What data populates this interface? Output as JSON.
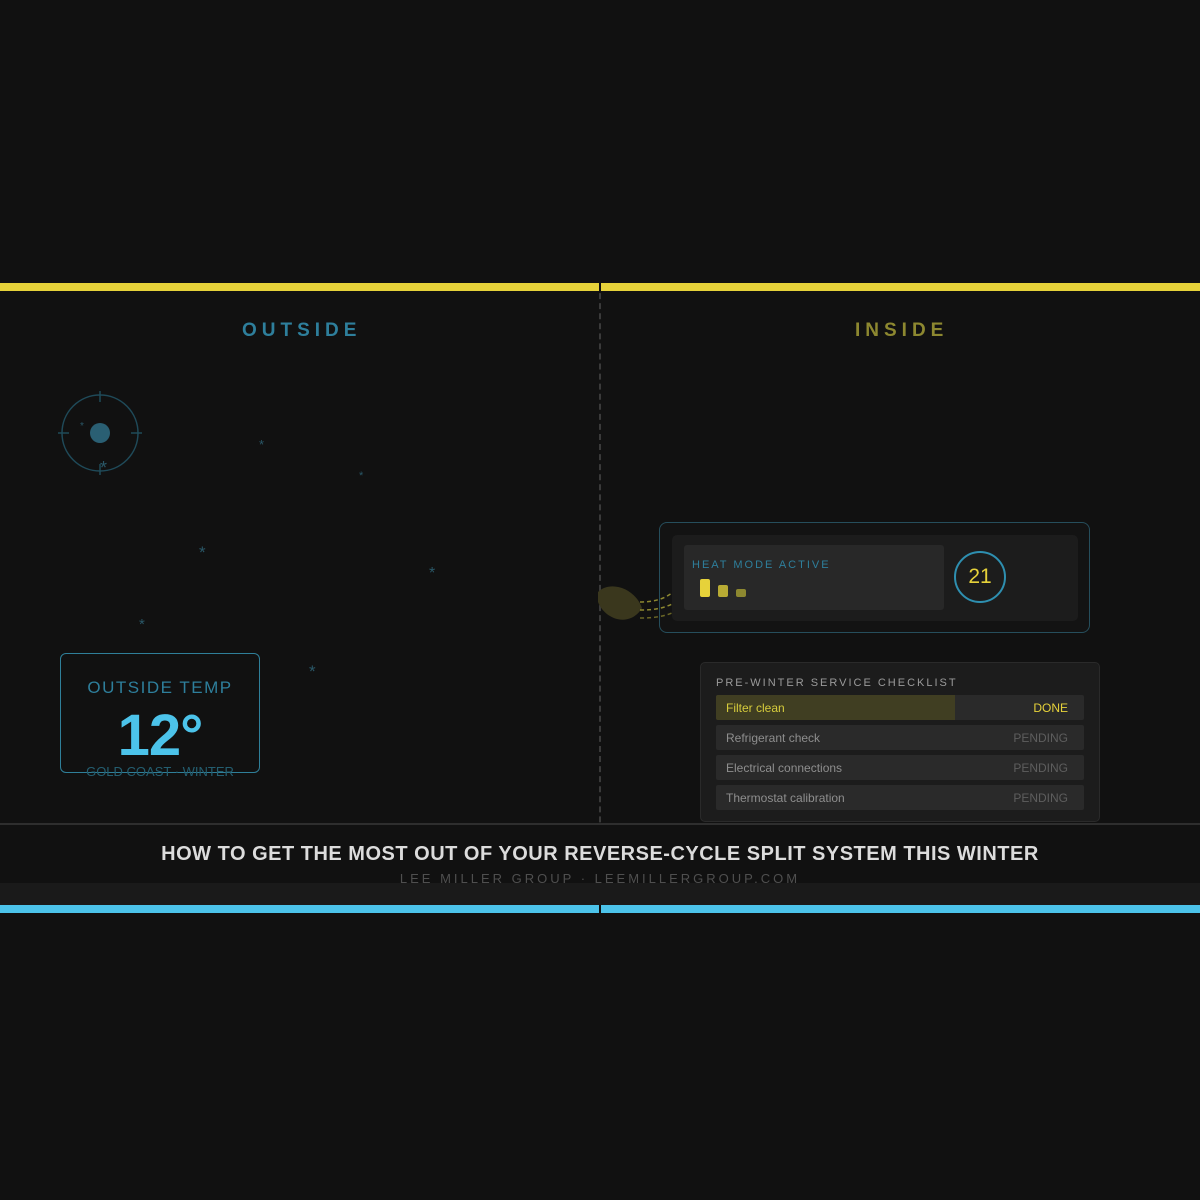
{
  "colors": {
    "accent_warm": "#e6d23a",
    "accent_cool": "#4cc3ea",
    "background": "#111111"
  },
  "outside": {
    "heading": "OUTSIDE",
    "icons": [
      "sun-icon",
      "snowflake-icon"
    ],
    "temp_card": {
      "label": "OUTSIDE TEMP",
      "value": "12°",
      "location": "GOLD COAST · WINTER"
    }
  },
  "inside": {
    "heading": "INSIDE",
    "ac_unit": {
      "mode_label": "HEAT MODE ACTIVE",
      "setpoint": "21"
    },
    "checklist": {
      "title": "PRE-WINTER SERVICE CHECKLIST",
      "items": [
        {
          "label": "Filter clean",
          "status": "DONE",
          "progress": 0.65
        },
        {
          "label": "Refrigerant check",
          "status": "PENDING",
          "progress": 0
        },
        {
          "label": "Electrical connections",
          "status": "PENDING",
          "progress": 0
        },
        {
          "label": "Thermostat calibration",
          "status": "PENDING",
          "progress": 0
        }
      ]
    }
  },
  "footer": {
    "title": "HOW TO GET THE MOST OUT OF YOUR REVERSE-CYCLE SPLIT SYSTEM THIS WINTER",
    "byline": "LEE MILLER GROUP · LEEMILLERGROUP.COM"
  }
}
